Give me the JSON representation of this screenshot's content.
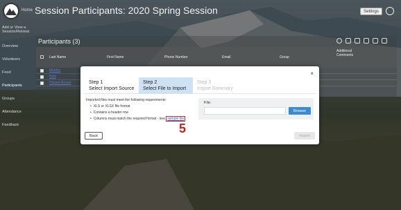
{
  "header": {
    "home_label": "Home",
    "title": "Session Participants: 2020 Spring Session",
    "settings_label": "Settings"
  },
  "sidebar": {
    "items": [
      {
        "label": "Add or View a Session/Retreat"
      },
      {
        "label": "Overview"
      },
      {
        "label": "Volunteers"
      },
      {
        "label": "Food"
      },
      {
        "label": "Participants"
      },
      {
        "label": "Groups"
      },
      {
        "label": "Attendance"
      },
      {
        "label": "Feedback"
      }
    ]
  },
  "panel": {
    "title": "Participants (3)"
  },
  "table": {
    "columns": [
      "Last Name",
      "First Name",
      "Phone Number",
      "Email",
      "Group",
      "Additional Comments"
    ],
    "rows": [
      {
        "name": "Mobley"
      },
      {
        "name": "Nolli"
      },
      {
        "name": "Holsen-Brown"
      }
    ]
  },
  "modal": {
    "steps": [
      {
        "number": "Step 1",
        "label": "Select Import Source"
      },
      {
        "number": "Step 2",
        "label": "Select File to Import"
      },
      {
        "number": "Step 3",
        "label": "Import Summary"
      }
    ],
    "requirements_intro": "Imported files must meet the following requirements:",
    "requirements": [
      "XLS or XLSX file format",
      "Contains a header row",
      "Columns must match the required format - see"
    ],
    "sample_link": "sample file",
    "file_label": "File:",
    "browse_label": "Browse",
    "back_label": "Back",
    "import_label": "Import",
    "close_glyph": "×"
  },
  "annotation": "5"
}
